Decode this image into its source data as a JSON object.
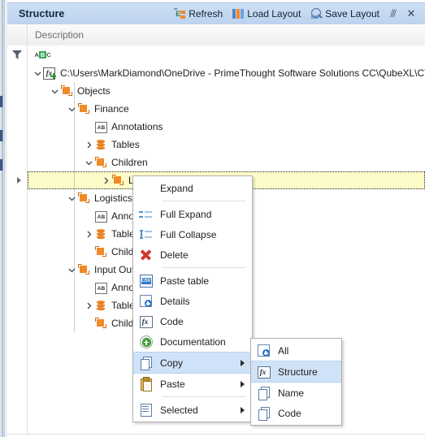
{
  "window": {
    "title": "Structure",
    "actions": [
      {
        "label": "Refresh",
        "icon": "refresh-icon"
      },
      {
        "label": "Load Layout",
        "icon": "load-layout-icon"
      },
      {
        "label": "Save Layout",
        "icon": "save-layout-icon"
      }
    ],
    "pin_glyph": "⫻",
    "close_glyph": "✕"
  },
  "grid": {
    "column_header": "Description",
    "filter_icon": "filter-icon",
    "filter_mode_icon": {
      "a": "A",
      "b": "B",
      "c": "C"
    }
  },
  "tree": {
    "rows": [
      {
        "label": "C:\\Users\\MarkDiamond\\OneDrive - PrimeThought Software Solutions CC\\QubeXL\\CTS.Qub…",
        "depth": 0,
        "icon": "formula-add-icon",
        "expander": "expanded",
        "selected": false
      },
      {
        "label": "Objects",
        "depth": 1,
        "icon": "object-icon",
        "expander": "expanded",
        "selected": false
      },
      {
        "label": "Finance",
        "depth": 2,
        "icon": "object-icon",
        "expander": "expanded",
        "selected": false
      },
      {
        "label": "Annotations",
        "depth": 3,
        "icon": "annotation-icon",
        "expander": "none",
        "selected": false
      },
      {
        "label": "Tables",
        "depth": 3,
        "icon": "tables-icon",
        "expander": "collapsed",
        "selected": false
      },
      {
        "label": "Children",
        "depth": 3,
        "icon": "object-icon",
        "expander": "expanded",
        "selected": false
      },
      {
        "label": "Logistics",
        "depth": 4,
        "icon": "object-icon",
        "expander": "collapsed",
        "selected": true
      },
      {
        "label": "Logistics",
        "depth": 2,
        "icon": "object-icon",
        "expander": "expanded",
        "selected": false
      },
      {
        "label": "Annotations",
        "depth": 3,
        "icon": "annotation-icon",
        "expander": "none",
        "selected": false
      },
      {
        "label": "Tables",
        "depth": 3,
        "icon": "tables-icon",
        "expander": "collapsed",
        "selected": false
      },
      {
        "label": "Children",
        "depth": 3,
        "icon": "object-icon",
        "expander": "none",
        "selected": false
      },
      {
        "label": "Input Output",
        "depth": 2,
        "icon": "object-icon",
        "expander": "expanded",
        "selected": false
      },
      {
        "label": "Annotations",
        "depth": 3,
        "icon": "annotation-icon",
        "expander": "none",
        "selected": false
      },
      {
        "label": "Tables",
        "depth": 3,
        "icon": "tables-icon",
        "expander": "collapsed",
        "selected": false
      },
      {
        "label": "Children",
        "depth": 3,
        "icon": "object-icon",
        "expander": "none",
        "selected": false
      }
    ]
  },
  "context_menu": {
    "items": [
      {
        "label": "Expand",
        "icon": "none",
        "submenu": false,
        "highlighted": false,
        "separator_after": true
      },
      {
        "label": "Full Expand",
        "icon": "full-expand-icon",
        "submenu": false,
        "highlighted": false,
        "separator_after": false
      },
      {
        "label": "Full Collapse",
        "icon": "full-collapse-icon",
        "submenu": false,
        "highlighted": false,
        "separator_after": false
      },
      {
        "label": "Delete",
        "icon": "delete-icon",
        "submenu": false,
        "highlighted": false,
        "separator_after": true
      },
      {
        "label": "Paste table",
        "icon": "csv-icon",
        "submenu": false,
        "highlighted": false,
        "separator_after": false
      },
      {
        "label": "Details",
        "icon": "details-icon",
        "submenu": false,
        "highlighted": false,
        "separator_after": false
      },
      {
        "label": "Code",
        "icon": "code-icon",
        "submenu": false,
        "highlighted": false,
        "separator_after": false
      },
      {
        "label": "Documentation",
        "icon": "documentation-icon",
        "submenu": false,
        "highlighted": false,
        "separator_after": false
      },
      {
        "label": "Copy",
        "icon": "copy-icon",
        "submenu": true,
        "highlighted": true,
        "separator_after": false
      },
      {
        "label": "Paste",
        "icon": "paste-icon",
        "submenu": true,
        "highlighted": false,
        "separator_after": true
      },
      {
        "label": "Selected",
        "icon": "selected-icon",
        "submenu": true,
        "highlighted": false,
        "separator_after": false
      }
    ]
  },
  "submenu": {
    "items": [
      {
        "label": "All",
        "icon": "details-icon",
        "highlighted": false
      },
      {
        "label": "Structure",
        "icon": "code-icon",
        "highlighted": true
      },
      {
        "label": "Name",
        "icon": "copy-icon",
        "highlighted": false
      },
      {
        "label": "Code",
        "icon": "copy-icon",
        "highlighted": false
      }
    ]
  },
  "colors": {
    "titlebar": "#c4d8f0",
    "accent_orange": "#f08a28",
    "selection_yellow": "#fdfbc8",
    "menu_highlight": "#cfe2f7"
  }
}
